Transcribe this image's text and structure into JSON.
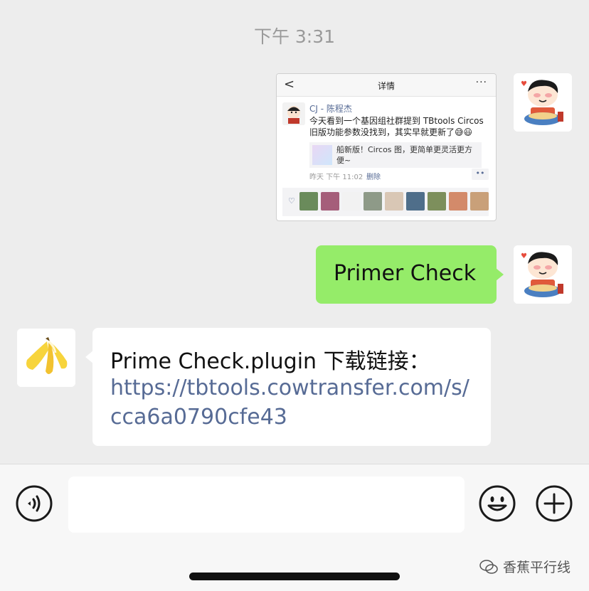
{
  "chat": {
    "timestamp": "下午 3:31",
    "screenshot_message": {
      "nav_title": "详情",
      "back_glyph": "<",
      "more_glyph": "···",
      "author": "CJ - 陈程杰",
      "text": "今天看到一个基因组社群提到 TBtools Circos 旧版功能参数没找到，其实早就更新了😅😃",
      "link_text": "船新版！Circos 图，更简单更灵活更方便~",
      "time": "昨天 下午 11:02",
      "delete": "删除",
      "dots": "••",
      "heart_icon": "♡",
      "like_colors": [
        "#6a8b5b",
        "#a55e7a",
        "#f2f2f2",
        "#8e9a88",
        "#d9c7b5",
        "#4f6e8a",
        "#7d8f5c",
        "#d38a6a",
        "#c9a079"
      ]
    },
    "sent_text": "Primer Check",
    "received": {
      "line1": "Prime Check.plugin 下载链接：",
      "link": "https://tbtools.cowtransfer.com/s/cca6a0790cfe43"
    }
  },
  "input_bar": {
    "voice_icon": "voice-icon",
    "emoji_icon": "emoji-icon",
    "plus_icon": "plus-icon",
    "input_value": ""
  },
  "watermark": {
    "text": "香蕉平行线",
    "icon": "wechat-icon"
  },
  "colors": {
    "background": "#ededed",
    "sent_bubble": "#95ec69",
    "received_bubble": "#ffffff",
    "link": "#576b95"
  }
}
